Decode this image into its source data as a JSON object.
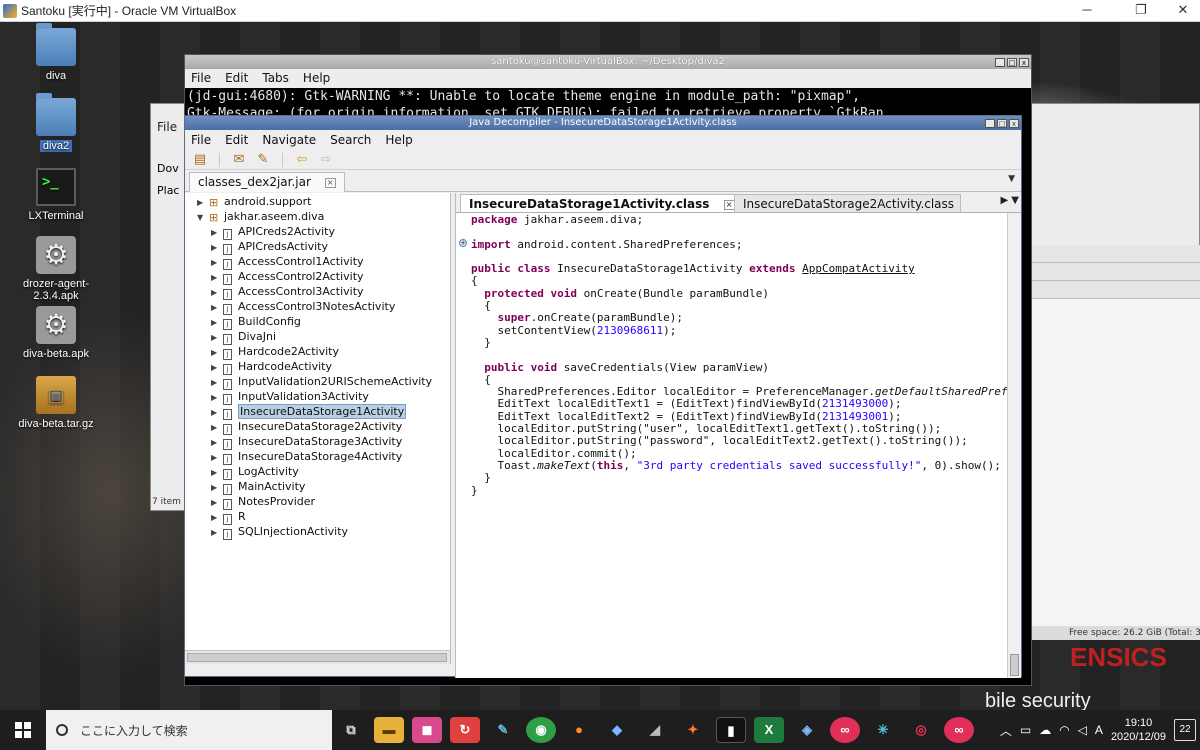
{
  "host": {
    "title": "Santoku [実行中] - Oracle VM VirtualBox"
  },
  "desktop": {
    "icons": [
      {
        "label": "diva",
        "icon": "folder-icon"
      },
      {
        "label": "diva2",
        "icon": "folder-icon"
      },
      {
        "label": "LXTerminal",
        "icon": "terminal-icon"
      },
      {
        "label": "drozer-agent-2.3.4.apk",
        "icon": "apk-gear-icon"
      },
      {
        "label": "diva-beta.apk",
        "icon": "apk-gear-icon"
      },
      {
        "label": "diva-beta.tar.gz",
        "icon": "archive-icon"
      }
    ],
    "wallpaper_text": "ENSICS",
    "wallpaper_subtext": "bile security"
  },
  "file_manager": {
    "menu_file": "File",
    "tab_do": "Dov",
    "tab_pla": "Plac",
    "items_count": "7 item",
    "free_space": "Free space: 26.2 GiB (Total: 35"
  },
  "terminal": {
    "title": "santoku@santoku-VirtualBox: ~/Desktop/diva2",
    "menu": [
      "File",
      "Edit",
      "Tabs",
      "Help"
    ],
    "lines": [
      "(jd-gui:4680): Gtk-WARNING **: Unable to locate theme engine in module_path: \"pixmap\",",
      "Gtk-Message: (for origin information, set GTK_DEBUG): failed to retrieve property `GtkRan"
    ]
  },
  "jdgui": {
    "title": "Java Decompiler - InsecureDataStorage1Activity.class",
    "menu": [
      "File",
      "Edit",
      "Navigate",
      "Search",
      "Help"
    ],
    "file_tab": "classes_dex2jar.jar",
    "tree": {
      "packages": [
        "android.support",
        "jakhar.aseem.diva"
      ],
      "classes": [
        "APICreds2Activity",
        "APICredsActivity",
        "AccessControl1Activity",
        "AccessControl2Activity",
        "AccessControl3Activity",
        "AccessControl3NotesActivity",
        "BuildConfig",
        "DivaJni",
        "Hardcode2Activity",
        "HardcodeActivity",
        "InputValidation2URISchemeActivity",
        "InputValidation3Activity",
        "InsecureDataStorage1Activity",
        "InsecureDataStorage2Activity",
        "InsecureDataStorage3Activity",
        "InsecureDataStorage4Activity",
        "LogActivity",
        "MainActivity",
        "NotesProvider",
        "R",
        "SQLInjectionActivity"
      ],
      "selected": "InsecureDataStorage1Activity"
    },
    "editor_tabs": [
      {
        "label": "InsecureDataStorage1Activity.class",
        "active": true
      },
      {
        "label": "InsecureDataStorage2Activity.class",
        "active": false
      }
    ],
    "code": {
      "package": "jakhar.aseem.diva",
      "import": "android.content.SharedPreferences",
      "class_name": "InsecureDataStorage1Activity",
      "superclass": "AppCompatActivity",
      "bundle_param": "(Bundle paramBundle)",
      "content_view_id": "2130968611",
      "save_sig": "saveCredentials(View paramView)",
      "editor_line": "SharedPreferences.Editor localEditor = PreferenceManager.",
      "editor_method": "getDefaultSharedPrefer",
      "edit_text_id_1": "2131493000",
      "edit_text_id_2": "2131493001",
      "put_user": "localEditor.putString(\"user\", localEditText1.getText().toString());",
      "put_password": "localEditor.putString(\"password\", localEditText2.getText().toString());",
      "commit": "localEditor.commit();",
      "toast_msg": "\"3rd party credentials saved successfully!\""
    }
  },
  "taskbar": {
    "search_placeholder": "ここに入力して検索",
    "time": "19:10",
    "date": "2020/12/09",
    "ime": "A",
    "notifications": "22"
  },
  "colors": {
    "keyword": "#7f0055",
    "number": "#2a00ff",
    "selection": "#b9cfe6",
    "title_blue": "#4b6ea3"
  }
}
